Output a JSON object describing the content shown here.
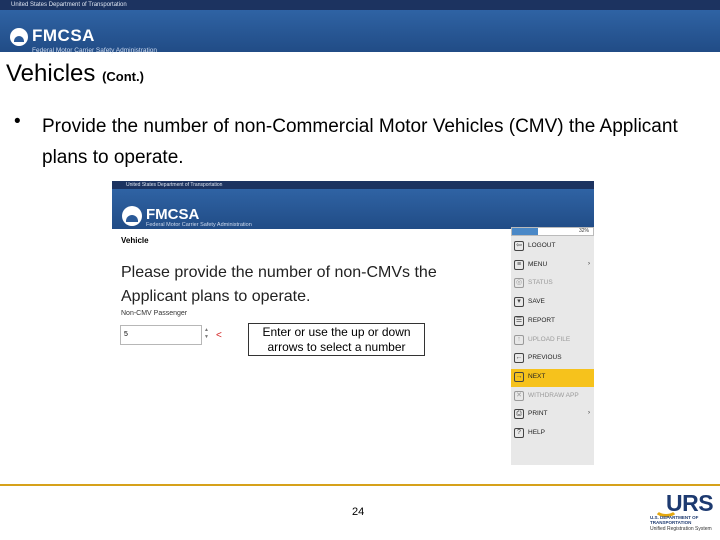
{
  "slide": {
    "top_strip": "United States Department of Transportation",
    "brand": "FMCSA",
    "brand_sub": "Federal Motor Carrier Safety Administration",
    "heading": "Vehicles",
    "heading_small": "(Cont.)",
    "bullet_char": "•",
    "bullet_text": "Provide the number of non-Commercial Motor Vehicles (CMV) the Applicant plans to operate.",
    "page_number": "24",
    "logo": {
      "wordmark": "URS",
      "tagline": "U.S. DEPARTMENT OF TRANSPORTATION",
      "subline": "Unified Registration System"
    },
    "accent_color": "#d6a11a"
  },
  "screen": {
    "top_strip": "United States Department of Transportation",
    "brand": "FMCSA",
    "brand_sub": "Federal Motor Carrier Safety Administration",
    "section_title": "Vehicle",
    "question": "Please provide the number of non-CMVs the Applicant plans to operate.",
    "field_label": "Non-CMV Passenger",
    "field_value": "5",
    "field_arrow": "<",
    "callout": "Enter or use the up or down arrows to select a number",
    "progress": {
      "label": "32%",
      "percent": 32
    },
    "menu": [
      {
        "label": "LOGOUT",
        "icon": "logout-icon",
        "glyph": "⇦",
        "state": "normal"
      },
      {
        "label": "MENU",
        "icon": "menu-icon",
        "glyph": "≡",
        "state": "normal",
        "caret": "›"
      },
      {
        "label": "STATUS",
        "icon": "status-icon",
        "glyph": "◎",
        "state": "disabled"
      },
      {
        "label": "SAVE",
        "icon": "save-icon",
        "glyph": "▾",
        "state": "normal"
      },
      {
        "label": "REPORT",
        "icon": "report-icon",
        "glyph": "☰",
        "state": "normal"
      },
      {
        "label": "UPLOAD FILE",
        "icon": "upload-icon",
        "glyph": "↑",
        "state": "disabled"
      },
      {
        "label": "PREVIOUS",
        "icon": "previous-icon",
        "glyph": "←",
        "state": "normal"
      },
      {
        "label": "NEXT",
        "icon": "next-icon",
        "glyph": "→",
        "state": "active"
      },
      {
        "label": "WITHDRAW APP",
        "icon": "withdraw-icon",
        "glyph": "✕",
        "state": "disabled"
      },
      {
        "label": "PRINT",
        "icon": "print-icon",
        "glyph": "⎙",
        "state": "normal",
        "caret": "›"
      },
      {
        "label": "HELP",
        "icon": "help-icon",
        "glyph": "?",
        "state": "normal"
      }
    ],
    "active_color": "#f6c21c"
  }
}
